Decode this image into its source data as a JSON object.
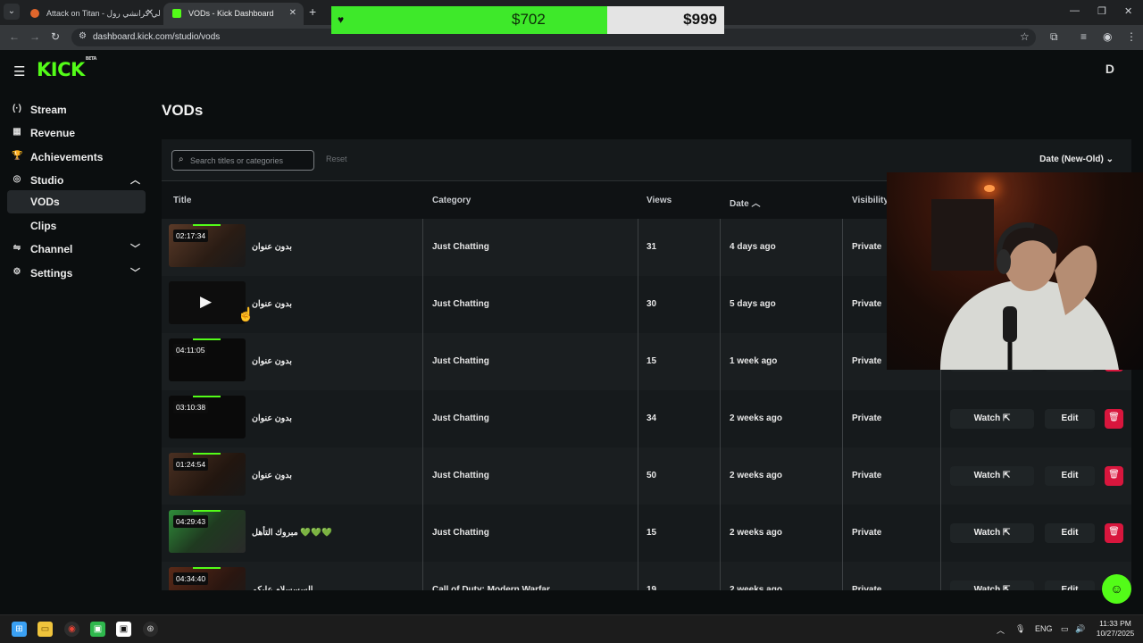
{
  "browser": {
    "tabs": [
      {
        "title": "Attack on Titan - لي كرانشي رول"
      },
      {
        "title": "VODs - Kick Dashboard"
      }
    ],
    "url": "dashboard.kick.com/studio/vods"
  },
  "goal_overlay": {
    "current": "$702",
    "target": "$999",
    "progress": 0.702,
    "accent": "#3ee92a"
  },
  "app": {
    "logo": "KICK",
    "logo_badge": "BETA",
    "user_initial": "D"
  },
  "sidebar": {
    "items": [
      {
        "label": "Stream",
        "icon": "broadcast-icon"
      },
      {
        "label": "Revenue",
        "icon": "revenue-icon"
      },
      {
        "label": "Achievements",
        "icon": "trophy-icon"
      },
      {
        "label": "Studio",
        "icon": "studio-icon"
      },
      {
        "label": "VODs"
      },
      {
        "label": "Clips"
      },
      {
        "label": "Channel",
        "icon": "channel-icon"
      },
      {
        "label": "Settings",
        "icon": "gear-icon"
      }
    ]
  },
  "main": {
    "title": "VODs",
    "search_placeholder": "Search titles or categories",
    "reset_label": "Reset",
    "sort_label": "Date (New-Old)",
    "columns": [
      "Title",
      "Category",
      "Views",
      "Date",
      "Visibility"
    ],
    "rows": [
      {
        "duration": "02:17:34",
        "title": "بدون عنوان",
        "category": "Just Chatting",
        "views": "31",
        "date": "4 days ago",
        "visibility": "Private"
      },
      {
        "duration": "",
        "title": "بدون عنوان",
        "category": "Just Chatting",
        "views": "30",
        "date": "5 days ago",
        "visibility": "Private"
      },
      {
        "duration": "04:11:05",
        "title": "بدون عنوان",
        "category": "Just Chatting",
        "views": "15",
        "date": "1 week ago",
        "visibility": "Private"
      },
      {
        "duration": "03:10:38",
        "title": "بدون عنوان",
        "category": "Just Chatting",
        "views": "34",
        "date": "2 weeks ago",
        "visibility": "Private"
      },
      {
        "duration": "01:24:54",
        "title": "بدون عنوان",
        "category": "Just Chatting",
        "views": "50",
        "date": "2 weeks ago",
        "visibility": "Private"
      },
      {
        "duration": "04:29:43",
        "title": "💚💚💚 مبروك التأهل",
        "category": "Just Chatting",
        "views": "15",
        "date": "2 weeks ago",
        "visibility": "Private"
      },
      {
        "duration": "04:34:40",
        "title": "السسسلام عليكم",
        "category": "Call of Duty: Modern Warfar...",
        "views": "19",
        "date": "2 weeks ago",
        "visibility": "Private"
      }
    ],
    "actions": {
      "watch": "Watch",
      "edit": "Edit"
    }
  },
  "taskbar": {
    "lang": "ENG",
    "time": "11:33 PM",
    "date": "10/27/2025"
  }
}
